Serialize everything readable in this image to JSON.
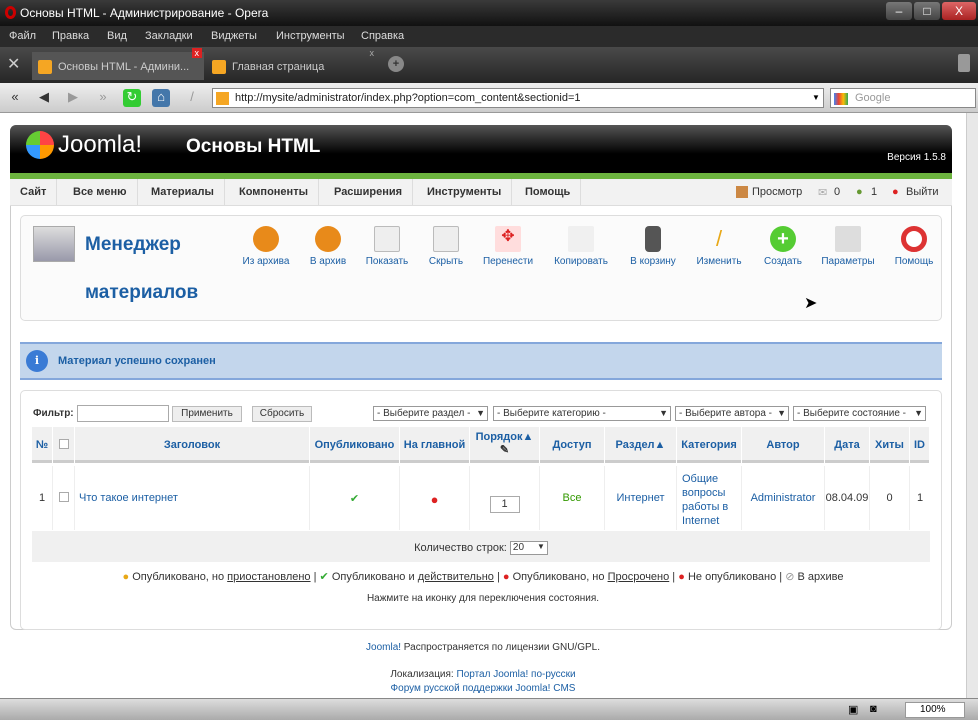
{
  "window": {
    "title": "Основы HTML - Администрирование - Opera",
    "min": "–",
    "max": "□",
    "close": "X"
  },
  "menu": [
    "Файл",
    "Правка",
    "Вид",
    "Закладки",
    "Виджеты",
    "Инструменты",
    "Справка"
  ],
  "tabs": [
    {
      "label": "Основы HTML - Админи..."
    },
    {
      "label": "Главная страница"
    }
  ],
  "address": {
    "url": "http://mysite/administrator/index.php?option=com_content&sectionid=1",
    "search_placeholder": "Google"
  },
  "joomla": {
    "logo": "Joomla!",
    "site_title": "Основы HTML",
    "version": "Версия 1.5.8"
  },
  "nav": {
    "items": [
      "Сайт",
      "Все меню",
      "Материалы",
      "Компоненты",
      "Расширения",
      "Инструменты",
      "Помощь"
    ],
    "preview": "Просмотр",
    "messages": "0",
    "users": "1",
    "logout": "Выйти"
  },
  "toolbar": {
    "title1": "Менеджер",
    "title2": "материалов",
    "buttons": [
      "Из архива",
      "В архив",
      "Показать",
      "Скрыть",
      "Перенести",
      "Копировать",
      "В корзину",
      "Изменить",
      "Создать",
      "Параметры",
      "Помощь"
    ]
  },
  "message": "Материал успешно сохранен",
  "filter": {
    "label": "Фильтр:",
    "value": "",
    "apply": "Применить",
    "reset": "Сбросить",
    "section": "- Выберите раздел -",
    "category": "- Выберите категорию -",
    "author": "- Выберите автора -",
    "state": "- Выберите состояние -"
  },
  "table": {
    "headers": [
      "№",
      "",
      "Заголовок",
      "Опубликовано",
      "На главной",
      "Порядок▲",
      "Доступ",
      "Раздел▲",
      "Категория",
      "Автор",
      "Дата",
      "Хиты",
      "ID"
    ],
    "rows": [
      {
        "num": "1",
        "title": "Что такое интернет",
        "order": "1",
        "access": "Все",
        "section": "Интернет",
        "category": "Общие вопросы работы в Internet",
        "author": "Administrator",
        "date": "08.04.09",
        "hits": "0",
        "id": "1"
      }
    ],
    "rows_label": "Количество строк:",
    "rows_value": "20"
  },
  "legend": {
    "l1a": "Опубликовано, но ",
    "l1b": "приостановлено",
    "l2a": "Опубликовано и ",
    "l2b": "действительно",
    "l3a": "Опубликовано, но ",
    "l3b": "Просрочено",
    "l4": "Не опубликовано",
    "l5": "В архиве",
    "hint": "Нажмите на иконку для переключения состояния."
  },
  "footer": {
    "joomla": "Joomla!",
    "license": " Распространяется по лицензии GNU/GPL.",
    "loc": "Локализация: ",
    "portal": "Портал Joomla! по-русски",
    "forum": "Форум русской поддержки Joomla! CMS"
  },
  "status": {
    "zoom": "100%"
  },
  "colors": {
    "accent": "#1c5fa4",
    "green": "#6cb33e"
  }
}
